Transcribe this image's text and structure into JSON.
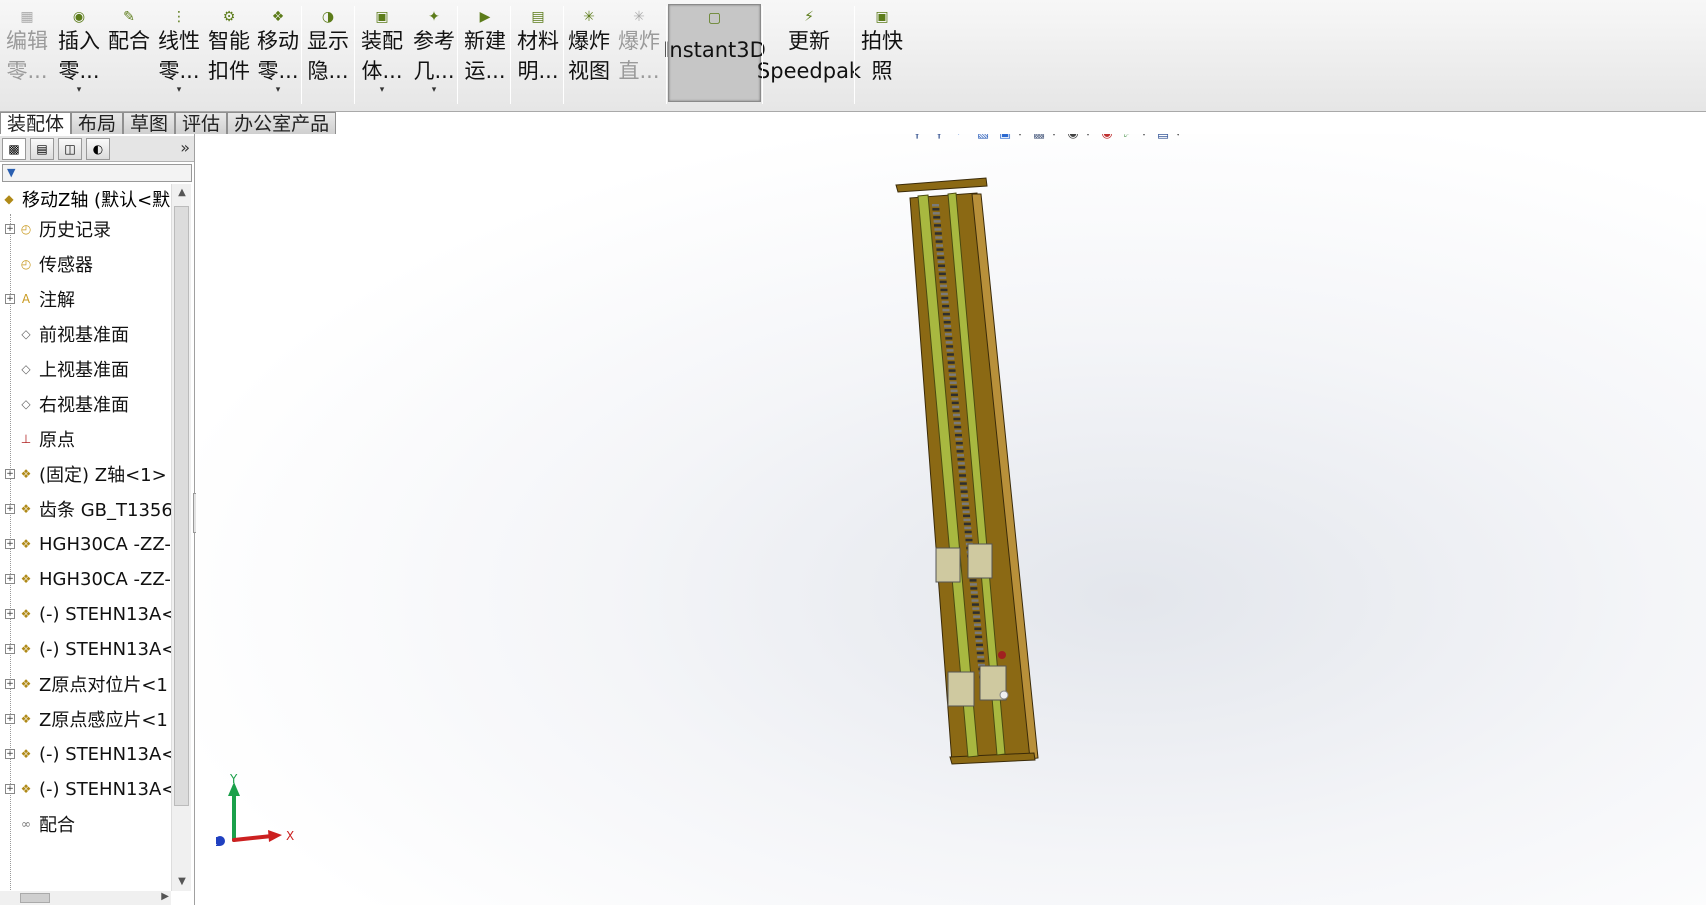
{
  "toolbar": {
    "buttons": [
      {
        "line1": "编辑",
        "line2": "零...",
        "icon": "edit-component-icon",
        "enabled": false,
        "arrow": false
      },
      {
        "line1": "插入",
        "line2": "零...",
        "icon": "insert-component-icon",
        "enabled": true,
        "arrow": true
      },
      {
        "line1": "配合",
        "line2": "",
        "icon": "mate-icon",
        "enabled": true,
        "arrow": false
      },
      {
        "line1": "线性",
        "line2": "零...",
        "icon": "linear-pattern-icon",
        "enabled": true,
        "arrow": true
      },
      {
        "line1": "智能",
        "line2": "扣件",
        "icon": "smart-fasteners-icon",
        "enabled": true,
        "arrow": false
      },
      {
        "line1": "移动",
        "line2": "零...",
        "icon": "move-component-icon",
        "enabled": true,
        "arrow": true
      },
      {
        "line1": "显示",
        "line2": "隐...",
        "icon": "show-hide-icon",
        "enabled": true,
        "arrow": false
      },
      {
        "line1": "装配",
        "line2": "体...",
        "icon": "assembly-features-icon",
        "enabled": true,
        "arrow": true
      },
      {
        "line1": "参考",
        "line2": "几...",
        "icon": "reference-geometry-icon",
        "enabled": true,
        "arrow": true
      },
      {
        "line1": "新建",
        "line2": "运...",
        "icon": "new-motion-study-icon",
        "enabled": true,
        "arrow": false
      },
      {
        "line1": "材料",
        "line2": "明...",
        "icon": "bill-of-materials-icon",
        "enabled": true,
        "arrow": false
      },
      {
        "line1": "爆炸",
        "line2": "视图",
        "icon": "exploded-view-icon",
        "enabled": true,
        "arrow": false
      },
      {
        "line1": "爆炸",
        "line2": "直...",
        "icon": "explode-line-sketch-icon",
        "enabled": false,
        "arrow": false
      },
      {
        "line1": "Instant3D",
        "line2": "",
        "icon": "instant3d-icon",
        "enabled": true,
        "arrow": false,
        "active": true
      },
      {
        "line1": "更新",
        "line2": "Speedpak",
        "icon": "update-speedpak-icon",
        "enabled": true,
        "arrow": false
      },
      {
        "line1": "拍快",
        "line2": "照",
        "icon": "take-snapshot-icon",
        "enabled": true,
        "arrow": false
      }
    ]
  },
  "tabs": [
    "装配体",
    "布局",
    "草图",
    "评估",
    "办公室产品"
  ],
  "panel": {
    "expand_glyph": "»",
    "tab_icons": [
      "feature-manager-icon",
      "property-manager-icon",
      "configuration-manager-icon",
      "display-manager-icon"
    ],
    "filter_glyph": "▼",
    "root": "移动Z轴  (默认<默",
    "items": [
      {
        "label": "历史记录",
        "icon": "history-folder-icon",
        "expand": true
      },
      {
        "label": "传感器",
        "icon": "sensors-folder-icon",
        "expand": false
      },
      {
        "label": "注解",
        "icon": "annotations-folder-icon",
        "expand": true
      },
      {
        "label": "前视基准面",
        "icon": "plane-icon",
        "expand": false
      },
      {
        "label": "上视基准面",
        "icon": "plane-icon",
        "expand": false
      },
      {
        "label": "右视基准面",
        "icon": "plane-icon",
        "expand": false
      },
      {
        "label": "原点",
        "icon": "origin-icon",
        "expand": false
      },
      {
        "label": "(固定) Z轴<1> (",
        "icon": "part-icon",
        "expand": true
      },
      {
        "label": "齿条 GB_T1356",
        "icon": "part-icon",
        "expand": true
      },
      {
        "label": "HGH30CA -ZZ-",
        "icon": "part-icon",
        "expand": true
      },
      {
        "label": "HGH30CA -ZZ-",
        "icon": "part-icon",
        "expand": true
      },
      {
        "label": "(-) STEHN13A<",
        "icon": "part-icon",
        "expand": true
      },
      {
        "label": "(-) STEHN13A<",
        "icon": "part-icon",
        "expand": true
      },
      {
        "label": "Z原点对位片<1",
        "icon": "part-icon",
        "expand": true
      },
      {
        "label": "Z原点感应片<1",
        "icon": "part-icon",
        "expand": true
      },
      {
        "label": "(-) STEHN13A<",
        "icon": "part-icon",
        "expand": true
      },
      {
        "label": "(-) STEHN13A<",
        "icon": "part-icon",
        "expand": true
      },
      {
        "label": "配合",
        "icon": "mates-folder-icon",
        "expand": false
      }
    ]
  },
  "viewport": {
    "hud_icons": [
      {
        "name": "zoom-to-fit-icon",
        "dropdown": false
      },
      {
        "name": "zoom-to-area-icon",
        "dropdown": false
      },
      {
        "name": "previous-view-icon",
        "dropdown": false
      },
      {
        "name": "section-view-icon",
        "dropdown": false
      },
      {
        "name": "view-orientation-icon",
        "dropdown": true
      },
      {
        "name": "display-style-icon",
        "dropdown": true
      },
      {
        "name": "hide-show-items-icon",
        "dropdown": true
      },
      {
        "name": "edit-appearance-icon",
        "dropdown": false
      },
      {
        "name": "apply-scene-icon",
        "dropdown": true
      },
      {
        "name": "view-settings-icon",
        "dropdown": true
      }
    ],
    "triad": {
      "y": "Y",
      "z": "Z",
      "x": "X"
    },
    "colors": {
      "frame": "#8b6914",
      "frame_light": "#b8903a",
      "rail_green": "#a8b840",
      "rail_dark": "#3a3a1a",
      "triad_y": "#1aa04a",
      "triad_x": "#cc2020",
      "triad_z": "#2040c0"
    }
  }
}
